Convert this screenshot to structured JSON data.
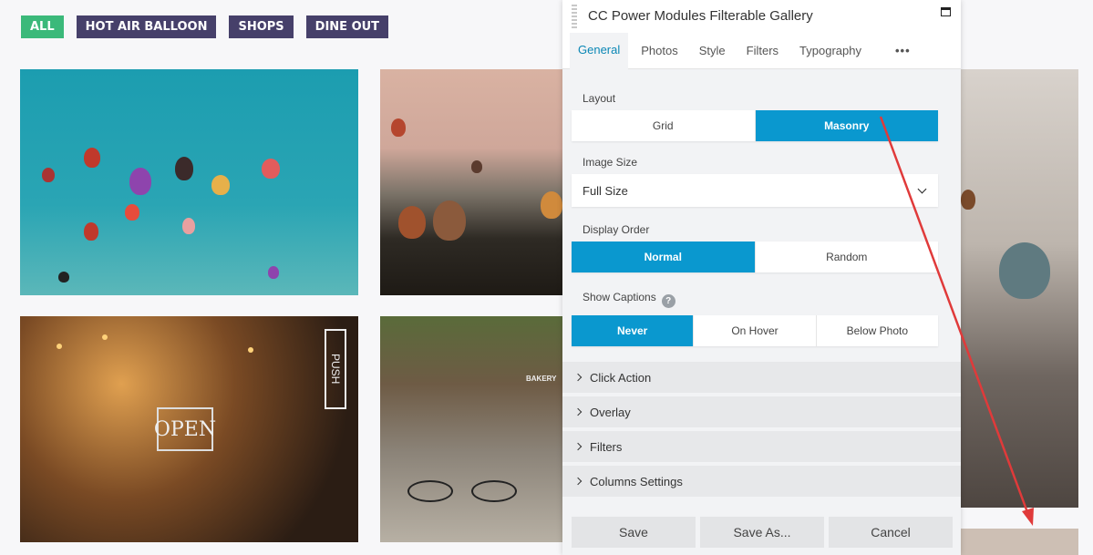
{
  "filters": [
    "ALL",
    "HOT AIR BALLOON",
    "SHOPS",
    "DINE OUT"
  ],
  "gallery": {
    "tiles": [
      {
        "label": "hot air balloons in sky"
      },
      {
        "label": "balloons at sunset"
      },
      {
        "label": "shop window open sign"
      },
      {
        "label": "street bakery"
      },
      {
        "label": "balloon over rocks"
      }
    ]
  },
  "panel": {
    "title": "CC Power Modules Filterable Gallery",
    "tabs": [
      "General",
      "Photos",
      "Style",
      "Filters",
      "Typography",
      "•••"
    ],
    "layout": {
      "label": "Layout",
      "options": [
        "Grid",
        "Masonry"
      ],
      "selected": "Masonry"
    },
    "image_size": {
      "label": "Image Size",
      "value": "Full Size"
    },
    "display_order": {
      "label": "Display Order",
      "options": [
        "Normal",
        "Random"
      ],
      "selected": "Normal"
    },
    "show_captions": {
      "label": "Show Captions",
      "help": "?",
      "options": [
        "Never",
        "On Hover",
        "Below Photo"
      ],
      "selected": "Never"
    },
    "sections": [
      "Click Action",
      "Overlay",
      "Filters",
      "Columns Settings"
    ],
    "footer": {
      "save": "Save",
      "save_as": "Save As...",
      "cancel": "Cancel"
    }
  },
  "colors": {
    "accent": "#0a98cf",
    "chip_active": "#3bb97a",
    "chip": "#46406a",
    "arrow": "#e03a3a"
  }
}
